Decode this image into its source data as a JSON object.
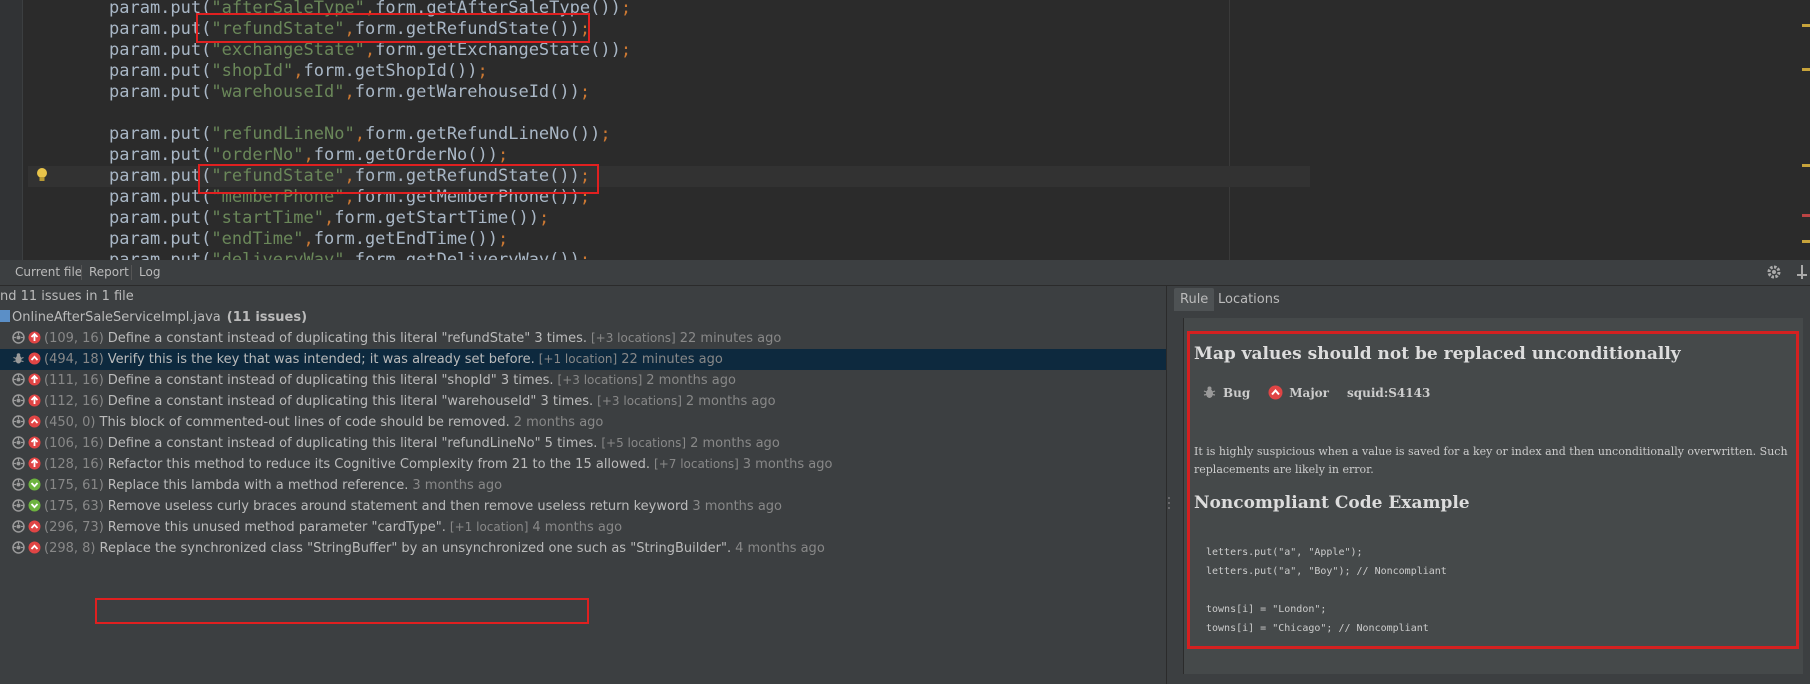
{
  "editor": {
    "lines": [
      {
        "key": "afterSaleType",
        "getter": "form.getAfterSaleType()"
      },
      {
        "key": "refundState",
        "getter": "form.getRefundState()"
      },
      {
        "key": "exchangeState",
        "getter": "form.getExchangeState()"
      },
      {
        "key": "shopId",
        "getter": "form.getShopId()"
      },
      {
        "key": "warehouseId",
        "getter": "form.getWarehouseId()"
      },
      {
        "key": "refundLineNo",
        "getter": "form.getRefundLineNo()"
      },
      {
        "key": "orderNo",
        "getter": "form.getOrderNo()"
      },
      {
        "key": "refundState",
        "getter": "form.getRefundState()"
      },
      {
        "key": "memberPhone",
        "getter": "form.getMemberPhone()"
      },
      {
        "key": "startTime",
        "getter": "form.getStartTime()"
      },
      {
        "key": "endTime",
        "getter": "form.getEndTime()"
      },
      {
        "key": "deliveryWay",
        "getter": "form.getDeliveryWay()"
      }
    ]
  },
  "tabs": [
    "Current file",
    "Report",
    "Log"
  ],
  "summary": "nd 11 issues in 1 file",
  "file": {
    "name": "OnlineAfterSaleServiceImpl.java",
    "count": "(11 issues)"
  },
  "issues": [
    {
      "type": "code-smell",
      "severity": "critical",
      "loc": "(109, 16)",
      "message": "Define a constant instead of duplicating this literal \"refundState\" 3 times.",
      "extra": "[+3 locations]",
      "age": "22 minutes ago"
    },
    {
      "type": "bug",
      "severity": "major",
      "loc": "(494, 18)",
      "message": "Verify this is the key that was intended; it was already set before.",
      "extra": "[+1 location]",
      "age": "22 minutes ago"
    },
    {
      "type": "code-smell",
      "severity": "critical",
      "loc": "(111, 16)",
      "message": "Define a constant instead of duplicating this literal \"shopId\" 3 times.",
      "extra": "[+3 locations]",
      "age": "2 months ago"
    },
    {
      "type": "code-smell",
      "severity": "critical",
      "loc": "(112, 16)",
      "message": "Define a constant instead of duplicating this literal \"warehouseId\" 3 times.",
      "extra": "[+3 locations]",
      "age": "2 months ago"
    },
    {
      "type": "code-smell",
      "severity": "major",
      "loc": "(450, 0)",
      "message": "This block of commented-out lines of code should be removed.",
      "extra": "",
      "age": "2 months ago"
    },
    {
      "type": "code-smell",
      "severity": "critical",
      "loc": "(106, 16)",
      "message": "Define a constant instead of duplicating this literal \"refundLineNo\" 5 times.",
      "extra": "[+5 locations]",
      "age": "2 months ago"
    },
    {
      "type": "code-smell",
      "severity": "critical",
      "loc": "(128, 16)",
      "message": "Refactor this method to reduce its Cognitive Complexity from 21 to the 15 allowed.",
      "extra": "[+7 locations]",
      "age": "3 months ago"
    },
    {
      "type": "code-smell",
      "severity": "minor",
      "loc": "(175, 61)",
      "message": "Replace this lambda with a method reference.",
      "extra": "",
      "age": "3 months ago"
    },
    {
      "type": "code-smell",
      "severity": "minor",
      "loc": "(175, 63)",
      "message": "Remove useless curly braces around statement and then remove useless return keyword",
      "extra": "",
      "age": "3 months ago"
    },
    {
      "type": "code-smell",
      "severity": "major",
      "loc": "(296, 73)",
      "message": "Remove this unused method parameter \"cardType\".",
      "extra": "[+1 location]",
      "age": "4 months ago"
    },
    {
      "type": "code-smell",
      "severity": "major",
      "loc": "(298, 8)",
      "message": "Replace the synchronized class \"StringBuffer\" by an unsynchronized one such as \"StringBuilder\".",
      "extra": "",
      "age": "4 months ago"
    }
  ],
  "rule_tabs": [
    "Rule",
    "Locations"
  ],
  "rule": {
    "title": "Map values should not be replaced unconditionally",
    "type": "Bug",
    "severity": "Major",
    "key": "squid:S4143",
    "description": "It is highly suspicious when a value is saved for a key or index and then unconditionally overwritten. Such replacements are likely in error.",
    "noncompliant_heading": "Noncompliant Code Example",
    "code": "letters.put(\"a\", \"Apple\");\nletters.put(\"a\", \"Boy\"); // Noncompliant\n\ntowns[i] = \"London\";\ntowns[i] = \"Chicago\"; // Noncompliant"
  },
  "colors": {
    "critical": "#e04545",
    "major": "#e04545",
    "minor": "#6db33f",
    "selection": "#0d293e",
    "highlight_border": "#e02020"
  }
}
